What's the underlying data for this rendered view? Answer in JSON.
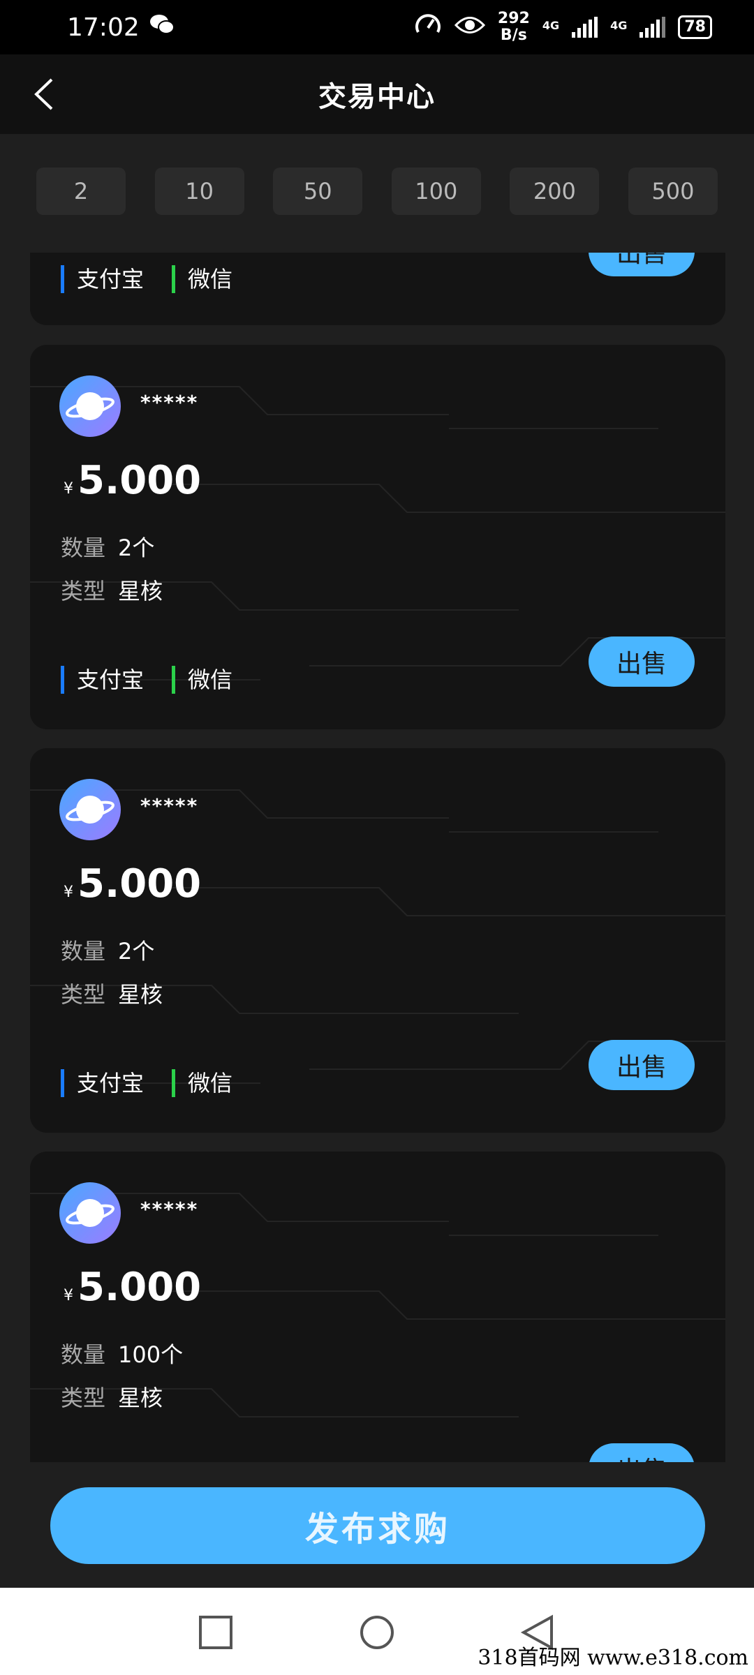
{
  "status_bar": {
    "time": "17:02",
    "speed_value": "292",
    "speed_unit": "B/s",
    "network_1": "4G",
    "network_2": "4G",
    "battery": "78"
  },
  "header": {
    "title": "交易中心"
  },
  "filters": [
    "2",
    "10",
    "50",
    "100",
    "200",
    "500"
  ],
  "listings": [
    {
      "partial": true,
      "pay_alipay": "支付宝",
      "pay_wechat": "微信",
      "sell_label": "出售"
    },
    {
      "user": "*****",
      "currency": "¥",
      "price": "5.000",
      "qty_label": "数量",
      "qty_value": "2个",
      "type_label": "类型",
      "type_value": "星核",
      "pay_alipay": "支付宝",
      "pay_wechat": "微信",
      "sell_label": "出售"
    },
    {
      "user": "*****",
      "currency": "¥",
      "price": "5.000",
      "qty_label": "数量",
      "qty_value": "2个",
      "type_label": "类型",
      "type_value": "星核",
      "pay_alipay": "支付宝",
      "pay_wechat": "微信",
      "sell_label": "出售"
    },
    {
      "user": "*****",
      "currency": "¥",
      "price": "5.000",
      "qty_label": "数量",
      "qty_value": "100个",
      "type_label": "类型",
      "type_value": "星核",
      "sell_label": "出售"
    }
  ],
  "publish_button": "发布求购",
  "watermark": "318首码网  www.e318.com",
  "colors": {
    "accent": "#4ab6ff",
    "alipay": "#1a7cff",
    "wechat": "#2bd14a"
  }
}
